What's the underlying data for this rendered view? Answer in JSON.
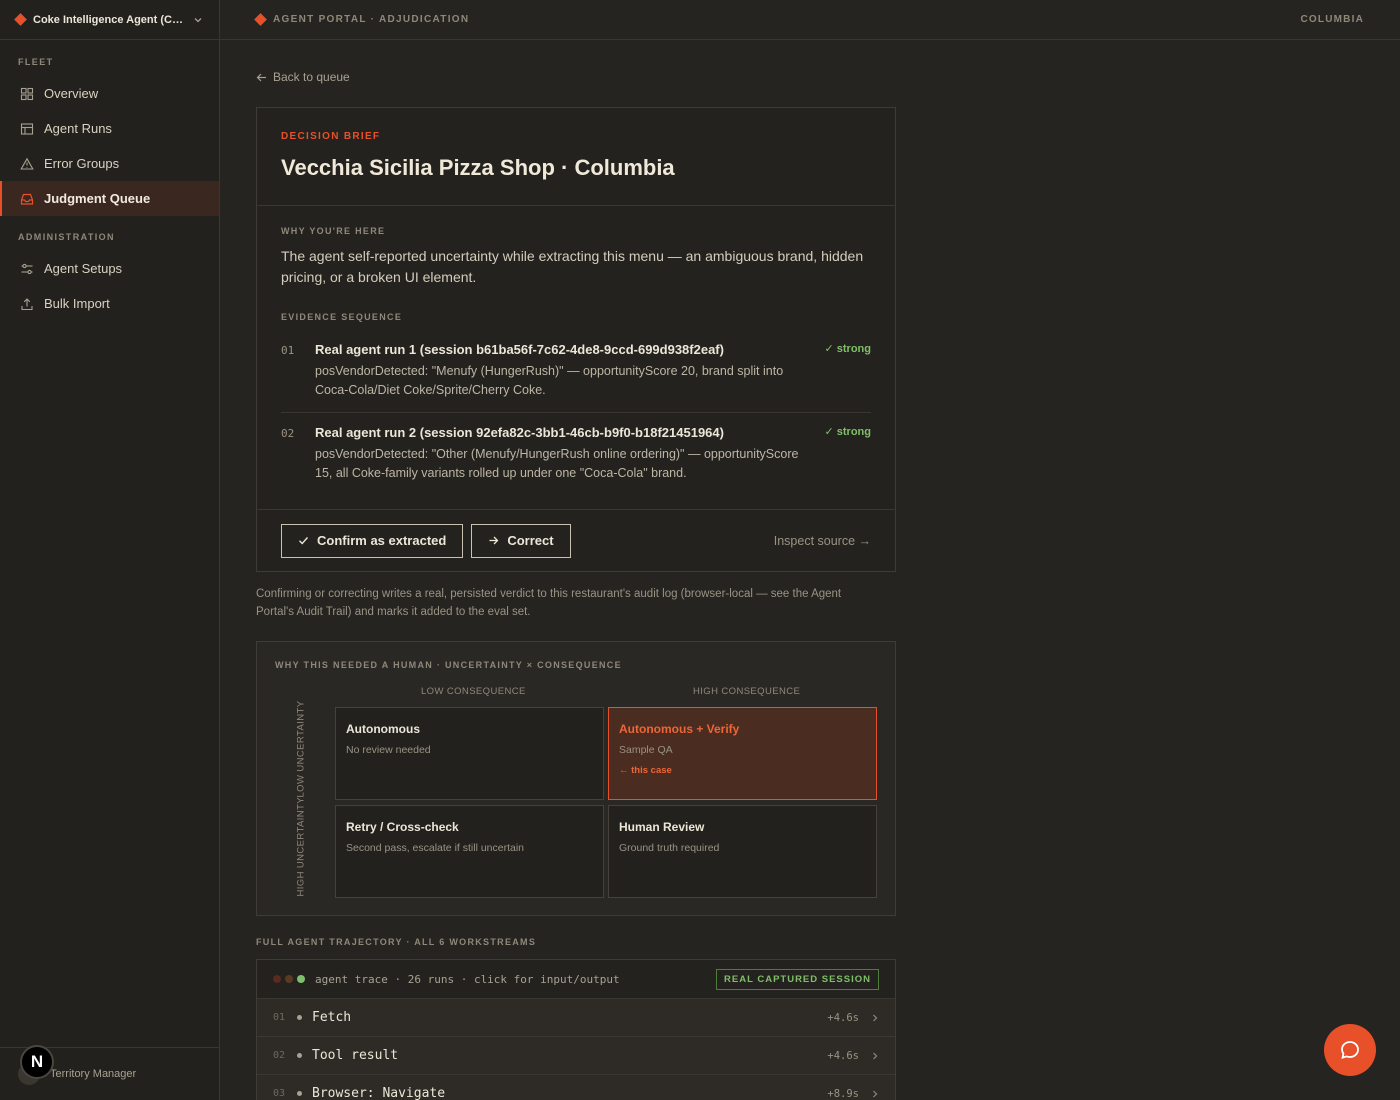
{
  "workspace": {
    "name": "Coke Intelligence Agent (Columbia)"
  },
  "sidebar": {
    "sections": [
      {
        "label": "FLEET",
        "items": [
          {
            "label": "Overview",
            "icon": "grid-icon"
          },
          {
            "label": "Agent Runs",
            "icon": "table-icon"
          },
          {
            "label": "Error Groups",
            "icon": "warning-icon"
          },
          {
            "label": "Judgment Queue",
            "icon": "inbox-icon",
            "active": true
          }
        ]
      },
      {
        "label": "ADMINISTRATION",
        "items": [
          {
            "label": "Agent Setups",
            "icon": "sliders-icon"
          },
          {
            "label": "Bulk Import",
            "icon": "upload-icon"
          }
        ]
      }
    ],
    "footer": {
      "role": "Territory Manager",
      "badge": "N"
    }
  },
  "topbar": {
    "breadcrumb": "AGENT PORTAL · ADJUDICATION",
    "region": "COLUMBIA"
  },
  "back_link": "Back to queue",
  "brief": {
    "eyebrow": "DECISION BRIEF",
    "title": "Vecchia Sicilia Pizza Shop · Columbia",
    "why_label": "WHY YOU'RE HERE",
    "why_text": "The agent self-reported uncertainty while extracting this menu — an ambiguous brand, hidden pricing, or a broken UI element.",
    "evidence_label": "EVIDENCE SEQUENCE",
    "evidence": [
      {
        "num": "01",
        "title": "Real agent run 1 (session b61ba56f-7c62-4de8-9ccd-699d938f2eaf)",
        "desc": "posVendorDetected: \"Menufy (HungerRush)\" — opportunityScore 20, brand split into Coca-Cola/Diet Coke/Sprite/Cherry Coke.",
        "tag": "✓ strong"
      },
      {
        "num": "02",
        "title": "Real agent run 2 (session 92efa82c-3bb1-46cb-b9f0-b18f21451964)",
        "desc": "posVendorDetected: \"Other (Menufy/HungerRush online ordering)\" — opportunityScore 15, all Coke-family variants rolled up under one \"Coca-Cola\" brand.",
        "tag": "✓ strong"
      }
    ],
    "actions": {
      "confirm": "Confirm as extracted",
      "correct": "Correct",
      "inspect": "Inspect source →"
    }
  },
  "note": "Confirming or correcting writes a real, persisted verdict to this restaurant's audit log (browser-local — see the Agent Portal's Audit Trail) and marks it added to the eval set.",
  "matrix": {
    "title": "WHY THIS NEEDED A HUMAN · UNCERTAINTY × CONSEQUENCE",
    "col_low": "LOW CONSEQUENCE",
    "col_high": "HIGH CONSEQUENCE",
    "row_low": "LOW UNCERTAINTY",
    "row_high": "HIGH UNCERTAINTY",
    "cells": [
      {
        "title": "Autonomous",
        "sub": "No review needed"
      },
      {
        "title": "Autonomous + Verify",
        "sub": "Sample QA",
        "marker": "← this case"
      },
      {
        "title": "Retry / Cross-check",
        "sub": "Second pass, escalate if still uncertain"
      },
      {
        "title": "Human Review",
        "sub": "Ground truth required"
      }
    ]
  },
  "trajectory": {
    "label": "FULL AGENT TRAJECTORY · ALL 6 WORKSTREAMS",
    "caption": "agent trace · 26 runs · click for input/output",
    "badge": "REAL CAPTURED SESSION",
    "rows": [
      {
        "num": "01",
        "name": "Fetch",
        "time": "+4.6s"
      },
      {
        "num": "02",
        "name": "Tool result",
        "time": "+4.6s"
      },
      {
        "num": "03",
        "name": "Browser: Navigate",
        "time": "+8.9s"
      }
    ]
  },
  "colors": {
    "accent": "#e8502a",
    "success": "#7fbf6a",
    "bg": "#262420"
  }
}
